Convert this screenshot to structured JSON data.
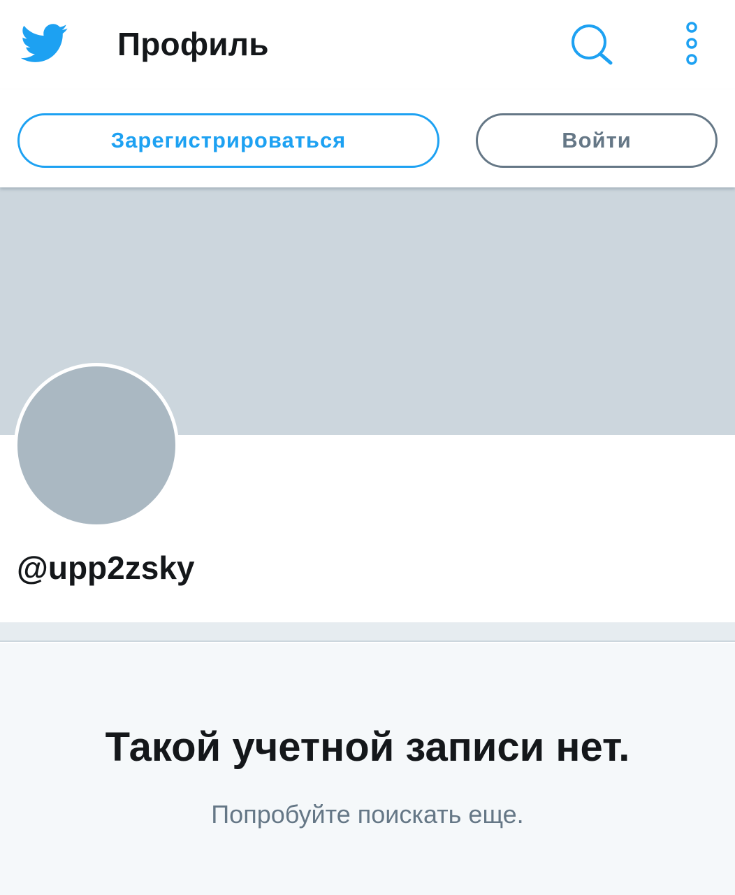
{
  "header": {
    "title": "Профиль",
    "logo_icon": "twitter-bird-icon",
    "search_icon": "search-icon",
    "more_icon": "more-vertical-icon"
  },
  "auth": {
    "signup_label": "Зарегистрироваться",
    "login_label": "Войти"
  },
  "profile": {
    "handle": "@upp2zsky"
  },
  "empty_state": {
    "title": "Такой учетной записи нет.",
    "subtitle": "Попробуйте поискать еще."
  },
  "colors": {
    "accent": "#1da1f2",
    "secondary": "#657786",
    "banner": "#ccd6dd",
    "avatar": "#aab8c2",
    "empty_bg": "#f5f8fa"
  }
}
